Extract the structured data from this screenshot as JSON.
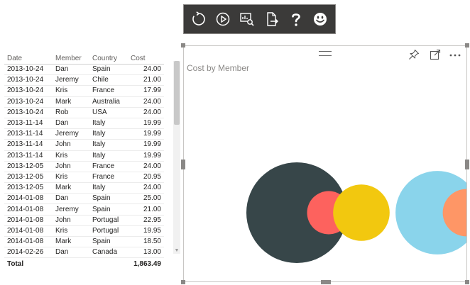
{
  "table": {
    "columns": [
      {
        "label": "Date"
      },
      {
        "label": "Member"
      },
      {
        "label": "Country"
      },
      {
        "label": "Cost"
      }
    ],
    "rows": [
      [
        "2013-10-24",
        "Dan",
        "Spain",
        "24.00"
      ],
      [
        "2013-10-24",
        "Jeremy",
        "Chile",
        "21.00"
      ],
      [
        "2013-10-24",
        "Kris",
        "France",
        "17.99"
      ],
      [
        "2013-10-24",
        "Mark",
        "Australia",
        "24.00"
      ],
      [
        "2013-10-24",
        "Rob",
        "USA",
        "24.00"
      ],
      [
        "2013-11-14",
        "Dan",
        "Italy",
        "19.99"
      ],
      [
        "2013-11-14",
        "Jeremy",
        "Italy",
        "19.99"
      ],
      [
        "2013-11-14",
        "John",
        "Italy",
        "19.99"
      ],
      [
        "2013-11-14",
        "Kris",
        "Italy",
        "19.99"
      ],
      [
        "2013-12-05",
        "John",
        "France",
        "24.00"
      ],
      [
        "2013-12-05",
        "Kris",
        "France",
        "20.95"
      ],
      [
        "2013-12-05",
        "Mark",
        "Italy",
        "24.00"
      ],
      [
        "2014-01-08",
        "Dan",
        "Spain",
        "25.00"
      ],
      [
        "2014-01-08",
        "Jeremy",
        "Spain",
        "21.00"
      ],
      [
        "2014-01-08",
        "John",
        "Portugal",
        "22.95"
      ],
      [
        "2014-01-08",
        "Kris",
        "Portugal",
        "19.95"
      ],
      [
        "2014-01-08",
        "Mark",
        "Spain",
        "18.50"
      ],
      [
        "2014-02-26",
        "Dan",
        "Canada",
        "13.00"
      ]
    ],
    "total_label": "Total",
    "total_value": "1,863.49"
  },
  "chart": {
    "title": "Cost by Member"
  },
  "chart_data": {
    "type": "scatter",
    "title": "Cost by Member",
    "grid": false,
    "legend": "none",
    "bubbles": [
      {
        "color": "#374649",
        "relative_size": 1.0
      },
      {
        "color": "#fd625e",
        "relative_size": 0.43
      },
      {
        "color": "#f2c80f",
        "relative_size": 0.56
      },
      {
        "color": "#8ad4eb",
        "relative_size": 0.83
      },
      {
        "color": "#fe9666",
        "relative_size": 0.47
      }
    ]
  },
  "toolbar": {
    "icons": [
      "refresh-icon",
      "play-icon",
      "data-view-icon",
      "export-icon",
      "help-icon",
      "smiley-icon"
    ]
  },
  "header_icons": [
    "pin-icon",
    "focus-mode-icon",
    "more-options-icon"
  ],
  "colors": {
    "toolbar_bg": "#3b3a39",
    "accent": "#374649"
  }
}
